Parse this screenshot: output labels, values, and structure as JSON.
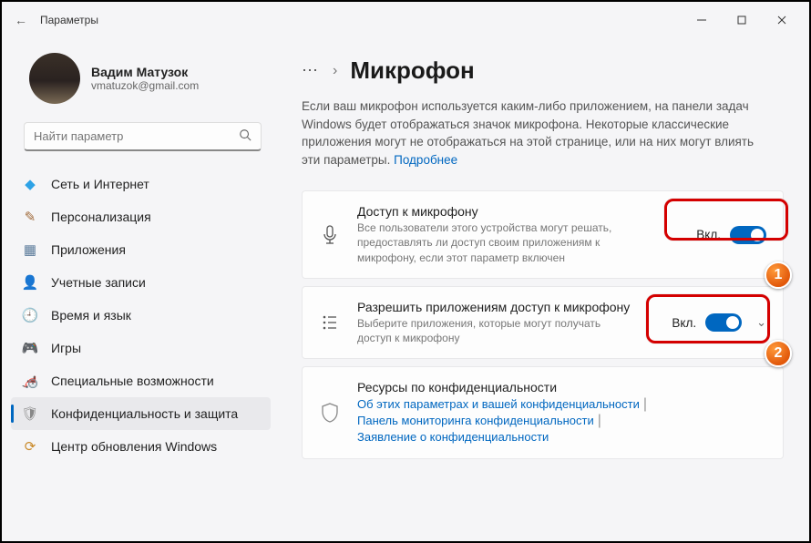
{
  "window": {
    "title": "Параметры"
  },
  "profile": {
    "name": "Вадим Матузок",
    "email": "vmatuzok@gmail.com"
  },
  "search": {
    "placeholder": "Найти параметр"
  },
  "sidebar": {
    "items": [
      {
        "label": "Сеть и Интернет",
        "icon": "💎"
      },
      {
        "label": "Персонализация",
        "icon": "🖌️"
      },
      {
        "label": "Приложения",
        "icon": "▦"
      },
      {
        "label": "Учетные записи",
        "icon": "👤"
      },
      {
        "label": "Время и язык",
        "icon": "🌐"
      },
      {
        "label": "Игры",
        "icon": "🎮"
      },
      {
        "label": "Специальные возможности",
        "icon": "♿"
      },
      {
        "label": "Конфиденциальность и защита",
        "icon": "🛡️"
      },
      {
        "label": "Центр обновления Windows",
        "icon": "🔄"
      }
    ]
  },
  "breadcrumb": {
    "dots": "⋯",
    "title": "Микрофон"
  },
  "description": {
    "text": "Если ваш микрофон используется каким-либо приложением, на панели задач Windows будет отображаться значок микрофона. Некоторые классические приложения могут не отображаться на этой странице, или на них могут влиять эти параметры.  ",
    "link": "Подробнее"
  },
  "cards": [
    {
      "title": "Доступ к микрофону",
      "sub": "Все пользователи этого устройства могут решать, предоставлять ли доступ своим приложениям к микрофону, если этот параметр включен",
      "toggle_label": "Вкл.",
      "toggle_on": true
    },
    {
      "title": "Разрешить приложениям доступ к микрофону",
      "sub": "Выберите приложения, которые могут получать доступ к микрофону",
      "toggle_label": "Вкл.",
      "toggle_on": true
    },
    {
      "title": "Ресурсы по конфиденциальности",
      "links": [
        "Об этих параметрах и вашей конфиденциальности",
        "Панель мониторинга конфиденциальности",
        "Заявление о конфиденциальности"
      ]
    }
  ],
  "annotations": {
    "badge1": "1",
    "badge2": "2"
  }
}
